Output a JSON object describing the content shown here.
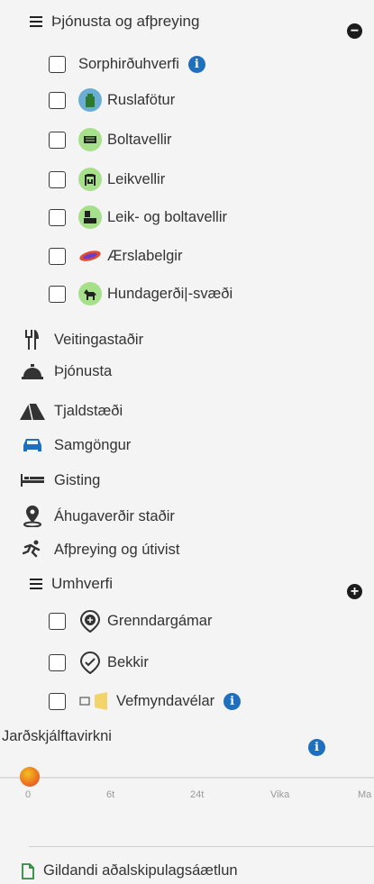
{
  "sections": {
    "thjonusta": {
      "title": "Þjónusta og afþreying",
      "toggle": "−",
      "items": [
        {
          "label": "Sorphirðuhverfi",
          "icon": "info-icon",
          "has_info": true,
          "checked": false
        },
        {
          "label": "Ruslafötur",
          "icon": "trash-bin-icon",
          "badge_color": "#6aaed6",
          "checked": false
        },
        {
          "label": "Boltavellir",
          "icon": "ball-field-icon",
          "badge_color": "#a6e08a",
          "checked": false
        },
        {
          "label": "Leikvellir",
          "icon": "playground-icon",
          "badge_color": "#a6e08a",
          "checked": false
        },
        {
          "label": "Leik- og boltavellir",
          "icon": "play-ball-field-icon",
          "badge_color": "#a6e08a",
          "checked": false
        },
        {
          "label": "Ærslabelgir",
          "icon": "bouncy-pillow-icon",
          "badge_color": "#e24b2f",
          "checked": false
        },
        {
          "label": "Hundagerði|-svæði",
          "icon": "dog-area-icon",
          "badge_color": "#a6e08a",
          "checked": false
        }
      ]
    },
    "categories": [
      {
        "label": "Veitingastaðir",
        "icon": "restaurant-icon"
      },
      {
        "label": "Þjónusta",
        "icon": "service-bell-icon"
      },
      {
        "label": "Tjaldstæði",
        "icon": "tent-icon"
      },
      {
        "label": "Samgöngur",
        "icon": "car-icon",
        "color": "#1f6fbf"
      },
      {
        "label": "Gisting",
        "icon": "bed-icon"
      },
      {
        "label": "Áhugaverðir staðir",
        "icon": "map-pin-icon"
      },
      {
        "label": "Afþreying og útivist",
        "icon": "running-person-icon"
      }
    ],
    "umhverfi": {
      "title": "Umhverfi",
      "toggle": "+",
      "items": [
        {
          "label": "Grenndargámar",
          "icon": "recycling-container-icon",
          "checked": false
        },
        {
          "label": "Bekkir",
          "icon": "bench-icon",
          "checked": false
        },
        {
          "label": "Vefmyndavélar",
          "icon": "webcam-icon",
          "has_info": true,
          "checked": false
        }
      ]
    }
  },
  "earthquake": {
    "title": "Jarðskjálftavirkni",
    "ticks": [
      "0",
      "6t",
      "24t",
      "Vika",
      "Ma"
    ]
  },
  "footer": {
    "link": "Gildandi aðalskipulagsáætlun"
  },
  "colors": {
    "info_blue": "#1f6fbf",
    "slider_start": "#e63b1e",
    "slider_end": "#f3c022"
  }
}
